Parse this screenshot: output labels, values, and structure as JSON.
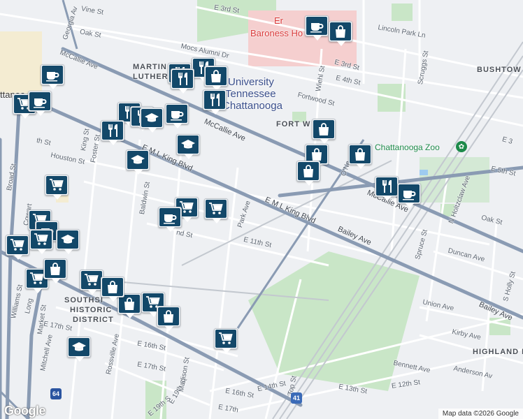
{
  "map": {
    "attribution": "Map data ©2026 Google",
    "logo": "Google",
    "colors": {
      "marker": "#134869",
      "road": "#8a9bb3",
      "park": "#c9e6c7",
      "hospital": "#f5cfcf"
    }
  },
  "labels": {
    "e3rd": "E 3rd St",
    "vine": "Vine St",
    "oak": "Oak St",
    "georgia": "Georgia Av",
    "mocs": "Mocs Alumni Dr",
    "baroness": "Baroness Ho",
    "er": "Er",
    "lincoln": "Lincoln Park Ln",
    "e3rd2": "E 3rd St",
    "bushtow": "BUSHTOW",
    "mccallie1": "McCallie Ave",
    "mlk1": "MARTIN",
    "mlk2": "LUTHER K",
    "univ1": "University",
    "univ2": "Tennessee",
    "univ3": "Chattanooga",
    "wiehl": "Wiehl St",
    "e4th": "E 4th St",
    "scruggs": "Scruggs St",
    "fortwood": "Fortwood St",
    "fortw": "FORT W",
    "mccallie2": "McCallie Ave",
    "zoo": "Chattanooga Zoo",
    "e3": "E 3",
    "king": "King St",
    "foster": "Foster St",
    "houston": "Houston St",
    "thst": "th St",
    "emlk1": "E M L King Blvd",
    "oneal": "O'Ne",
    "nholtzclaw": "N Holtzclaw Ave",
    "e5th": "E 5th St",
    "broad": "Broad St",
    "baldwin": "Baldwin St",
    "cowart": "Cowart",
    "parkave": "Park Ave",
    "emlk2": "E M L King Blvd",
    "mccallie3": "McCallie Ave",
    "oakst2": "Oak St",
    "e11th": "E 11th St",
    "ndst": "nd St",
    "bailey1": "Bailey Ave",
    "duncan": "Duncan Ave",
    "spruce": "Spruce St",
    "sholly": "S Holly St",
    "williams": "Williams St",
    "long": "Long",
    "market": "Market St",
    "southside1": "SOUTHSI",
    "southside2": "HISTORIC",
    "southside3": "DISTRICT",
    "union": "Union Ave",
    "bailey2": "Bailey Ave",
    "e17th": "E 17th St",
    "mitchell": "Mitchell Ave",
    "rossville": "Rossville Ave",
    "e16th": "E 16th St",
    "e17th2": "E 17th St",
    "kirby": "Kirby Ave",
    "highland": "HIGHLAND PA",
    "bennett": "Bennett Ave",
    "anderson": "Anderson Av",
    "e12th": "E 12th St",
    "e19th": "E 19th St",
    "madison": "Madison St",
    "e14th": "E 14th St",
    "top": "Top St",
    "e13th": "E 13th St",
    "e16th2": "E 16th St",
    "e17th3": "E 17th",
    "e19th2": "E 19th S",
    "attanoo": "ttanoo",
    "sh41": "41",
    "sh64": "64"
  },
  "markers": [
    {
      "type": "coffee-icon"
    },
    {
      "type": "shopping-bag-icon"
    },
    {
      "type": "restaurant-icon"
    },
    {
      "type": "restaurant-icon"
    },
    {
      "type": "shopping-bag-icon"
    },
    {
      "type": "coffee-icon"
    },
    {
      "type": "restaurant-icon"
    },
    {
      "type": "grocery-cart-icon"
    },
    {
      "type": "coffee-icon"
    },
    {
      "type": "restaurant-icon"
    },
    {
      "type": "restaurant-icon"
    },
    {
      "type": "restaurant-icon"
    },
    {
      "type": "school-icon"
    },
    {
      "type": "coffee-icon"
    },
    {
      "type": "restaurant-icon"
    },
    {
      "type": "school-icon"
    },
    {
      "type": "shopping-bag-icon"
    },
    {
      "type": "shopping-bag-icon"
    },
    {
      "type": "shopping-bag-icon"
    },
    {
      "type": "shopping-bag-icon"
    },
    {
      "type": "school-icon"
    },
    {
      "type": "restaurant-icon"
    },
    {
      "type": "coffee-icon"
    },
    {
      "type": "grocery-cart-icon"
    },
    {
      "type": "grocery-cart-icon"
    },
    {
      "type": "coffee-icon"
    },
    {
      "type": "grocery-cart-icon"
    },
    {
      "type": "grocery-cart-icon"
    },
    {
      "type": "coffee-icon"
    },
    {
      "type": "school-icon"
    },
    {
      "type": "grocery-cart-icon"
    },
    {
      "type": "grocery-cart-icon"
    },
    {
      "type": "grocery-cart-icon"
    },
    {
      "type": "shopping-bag-icon"
    },
    {
      "type": "grocery-cart-icon"
    },
    {
      "type": "shopping-bag-icon"
    },
    {
      "type": "shopping-bag-icon"
    },
    {
      "type": "grocery-cart-icon"
    },
    {
      "type": "shopping-bag-icon"
    },
    {
      "type": "school-icon"
    },
    {
      "type": "grocery-cart-icon"
    }
  ]
}
